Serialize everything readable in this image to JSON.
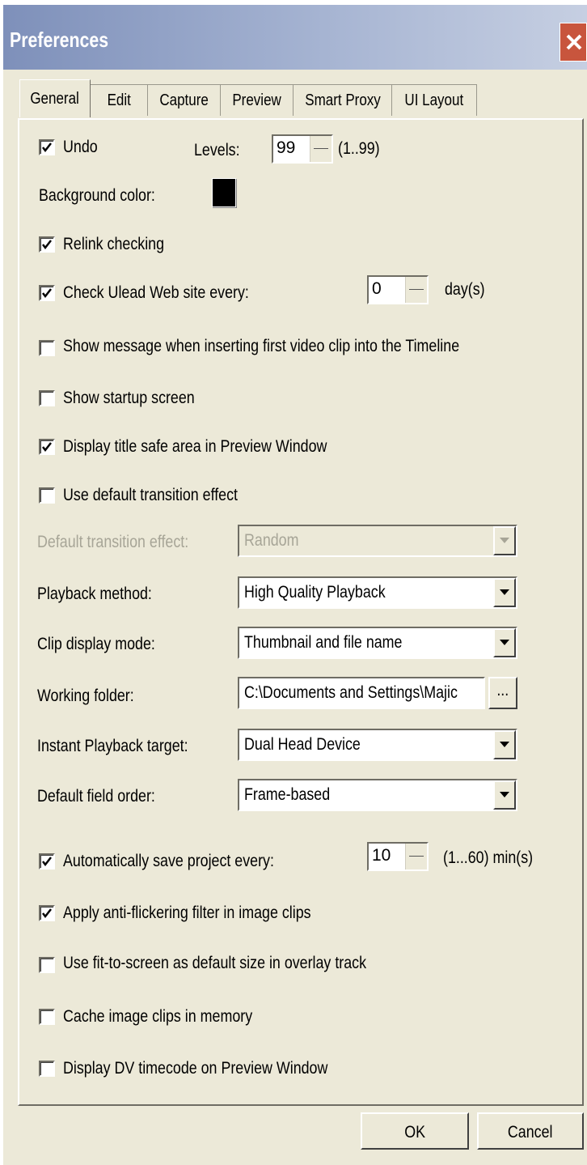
{
  "window": {
    "title": "Preferences"
  },
  "tabs": [
    "General",
    "Edit",
    "Capture",
    "Preview",
    "Smart Proxy",
    "UI Layout"
  ],
  "active_tab": "General",
  "undo": {
    "label": "Undo",
    "checked": true,
    "levels_label": "Levels:",
    "levels_value": "99",
    "levels_range": "(1..99)"
  },
  "background_color": {
    "label": "Background color:",
    "value": "#000000"
  },
  "relink": {
    "label": "Relink checking",
    "checked": true
  },
  "check_web": {
    "label": "Check Ulead Web site every:",
    "checked": true,
    "value": "0",
    "unit": "day(s)"
  },
  "show_message": {
    "label": "Show message when inserting first video clip into the Timeline",
    "checked": false
  },
  "startup_screen": {
    "label": "Show startup screen",
    "checked": false
  },
  "title_safe": {
    "label": "Display title safe area in Preview Window",
    "checked": true
  },
  "default_transition": {
    "label": "Use default transition effect",
    "checked": false
  },
  "fields": {
    "transition_effect": {
      "label": "Default transition effect:",
      "value": "Random",
      "disabled": true
    },
    "playback_method": {
      "label": "Playback method:",
      "value": "High Quality Playback"
    },
    "clip_display": {
      "label": "Clip display mode:",
      "value": "Thumbnail and file name"
    },
    "working_folder": {
      "label": "Working folder:",
      "value": "C:\\Documents and Settings\\Majic",
      "browse": "..."
    },
    "instant_playback": {
      "label": "Instant Playback target:",
      "value": "Dual Head Device"
    },
    "field_order": {
      "label": "Default field order:",
      "value": "Frame-based"
    }
  },
  "autosave": {
    "label": "Automatically save project every:",
    "checked": true,
    "value": "10",
    "range": "(1...60) min(s)"
  },
  "anti_flicker": {
    "label": "Apply anti-flickering filter in image clips",
    "checked": true
  },
  "fit_to_screen": {
    "label": "Use fit-to-screen as default size in overlay track",
    "checked": false
  },
  "cache_images": {
    "label": "Cache image clips in memory",
    "checked": false
  },
  "dv_timecode": {
    "label": "Display DV timecode on Preview Window",
    "checked": false
  },
  "buttons": {
    "ok": "OK",
    "cancel": "Cancel"
  },
  "icons": {
    "close": "close-icon",
    "dropdown": "chevron-down-icon",
    "check": "checkmark-icon"
  }
}
